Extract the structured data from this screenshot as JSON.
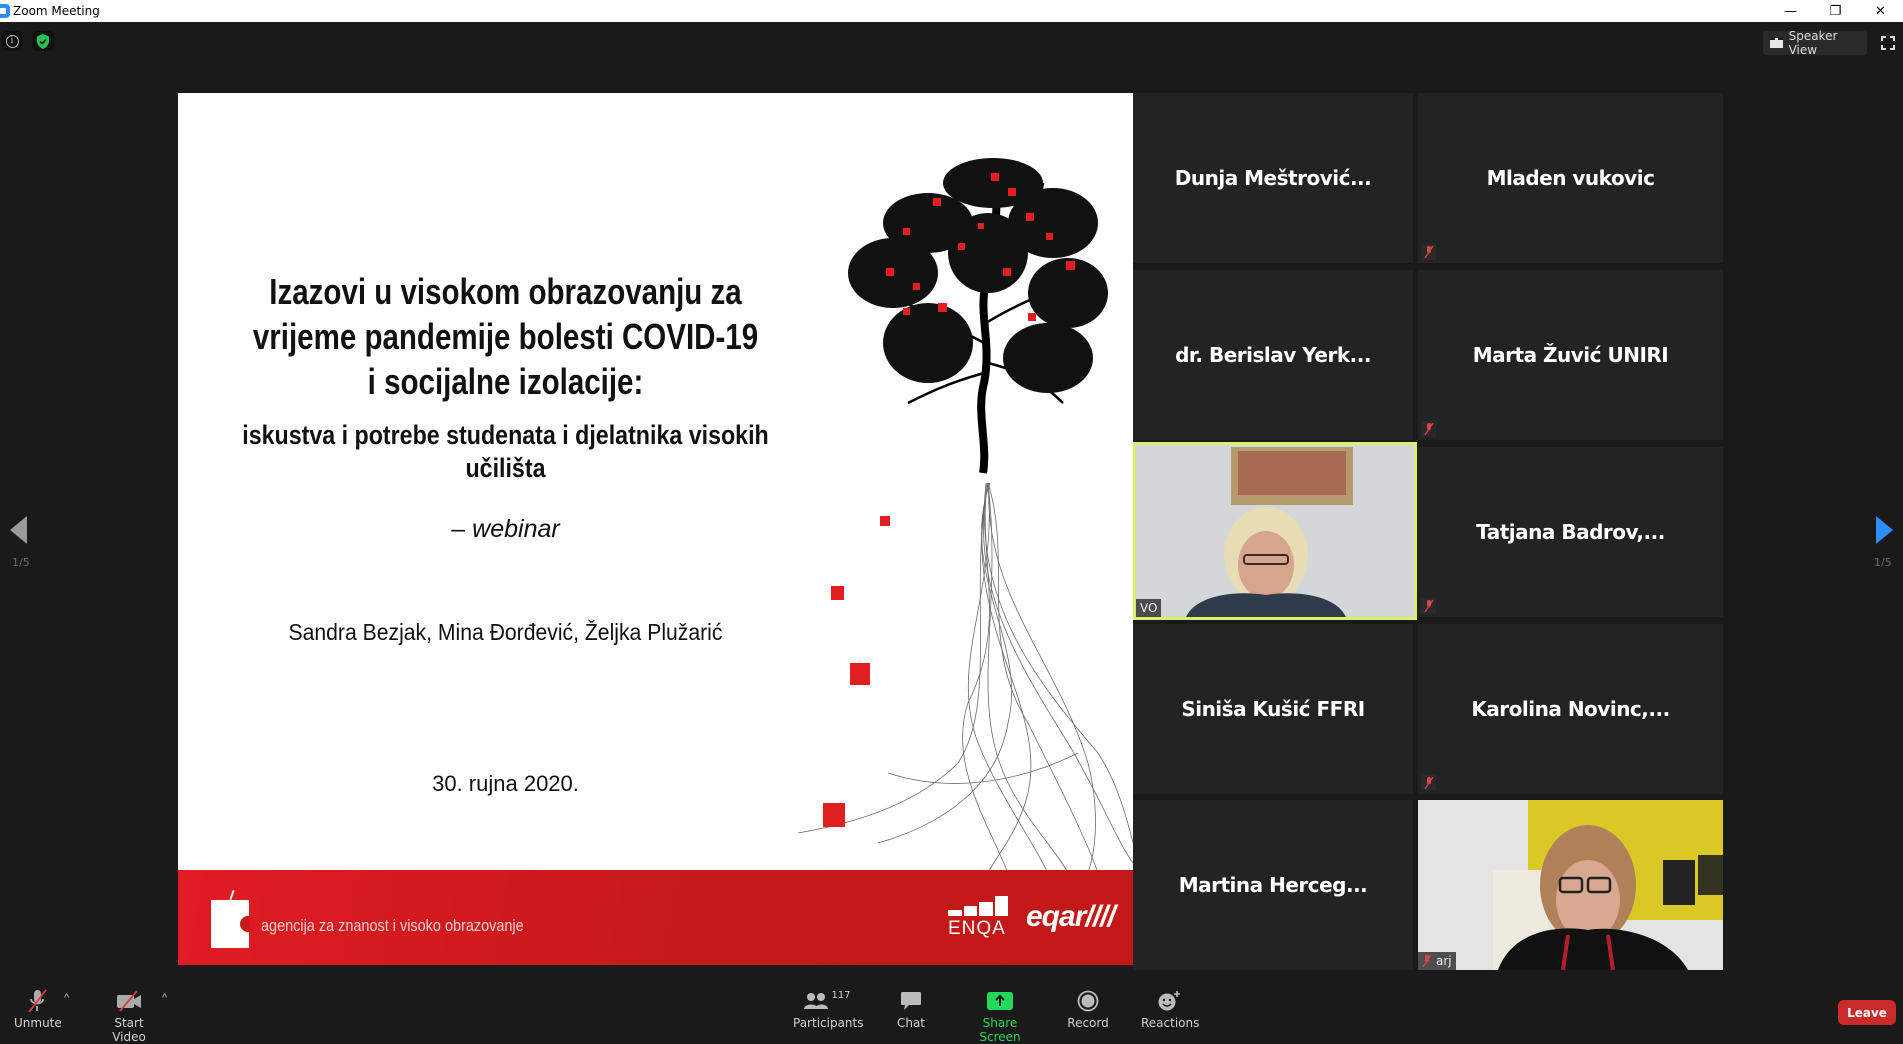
{
  "window": {
    "title": "Zoom Meeting",
    "controls": {
      "minimize": "—",
      "restore": "❐",
      "close": "✕"
    }
  },
  "topbar": {
    "info_icon": "i",
    "view_mode_label": "Speaker View"
  },
  "slide": {
    "title_lines": [
      "Izazovi u visokom obrazovanju za",
      "vrijeme pandemije bolesti COVID-19",
      "i socijalne izolacije:"
    ],
    "subtitle_lines": [
      "iskustva i potrebe studenata i djelatnika visokih",
      "učilišta"
    ],
    "webinar": "– webinar",
    "authors": "Sandra Bezjak, Mina Đorđević, Željka Plužarić",
    "date": "30. rujna 2020.",
    "footer_text": "agencija za znanost i visoko obrazovanje",
    "enqa_label": "ENQA",
    "eqar_label": "eqar////",
    "accent_color": "#d11f24"
  },
  "pagination": {
    "prev_page_label": "1/5",
    "next_page_label": "1/5"
  },
  "participants_tiles": [
    {
      "name": "Dunja  Meštrović...",
      "muted": false,
      "video": false
    },
    {
      "name": "Mladen vukovic",
      "muted": true,
      "video": false
    },
    {
      "name": "dr. Berislav Yerk...",
      "muted": false,
      "video": false
    },
    {
      "name": "Marta Žuvić UNIRI",
      "muted": true,
      "video": false
    },
    {
      "name": "",
      "label": "VO",
      "muted": false,
      "video": true,
      "active_speaker": true
    },
    {
      "name": "Tatjana  Badrov,...",
      "muted": true,
      "video": false
    },
    {
      "name": "Siniša Kušić FFRI",
      "muted": false,
      "video": false
    },
    {
      "name": "Karolina  Novinc,...",
      "muted": true,
      "video": false
    },
    {
      "name": "Martina  Herceg...",
      "muted": false,
      "video": false
    },
    {
      "name": "",
      "label": "arj",
      "muted": true,
      "video": true,
      "active_speaker": false
    }
  ],
  "toolbar": {
    "unmute": "Unmute",
    "start_video": "Start Video",
    "participants": "Participants",
    "participants_count": "117",
    "chat": "Chat",
    "share_screen": "Share Screen",
    "record": "Record",
    "reactions": "Reactions",
    "leave": "Leave",
    "share_color": "#23d959",
    "leave_color": "#c92a2a"
  }
}
